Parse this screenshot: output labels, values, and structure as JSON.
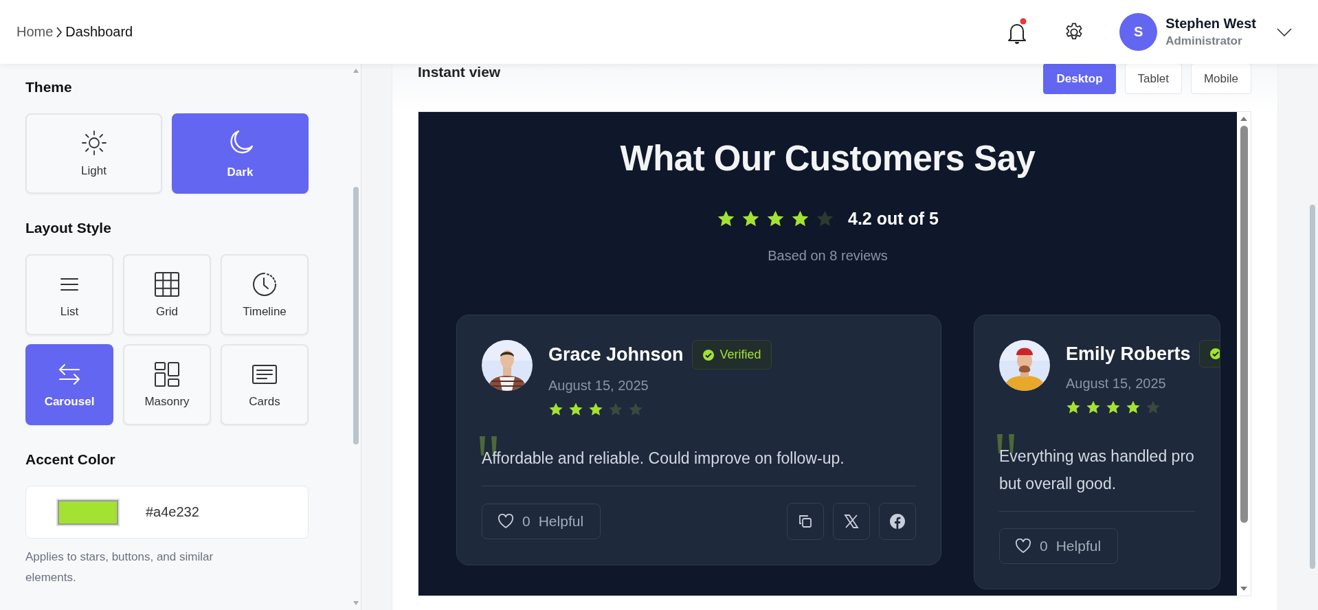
{
  "breadcrumb": [
    {
      "label": "Home"
    },
    {
      "label": "Dashboard"
    }
  ],
  "header": {
    "notifications": {
      "unread": true
    },
    "user": {
      "initial": "S",
      "name": "Stephen West",
      "role": "Administrator"
    }
  },
  "sidebar": {
    "theme": {
      "title": "Theme",
      "options": [
        {
          "label": "Light",
          "kind": "sun",
          "selected": false
        },
        {
          "label": "Dark",
          "kind": "moon",
          "selected": true
        }
      ]
    },
    "layout_style": {
      "title": "Layout Style",
      "options": [
        {
          "label": "List",
          "kind": "list",
          "selected": false
        },
        {
          "label": "Grid",
          "kind": "grid",
          "selected": false
        },
        {
          "label": "Timeline",
          "kind": "timeline",
          "selected": false
        },
        {
          "label": "Carousel",
          "kind": "carousel",
          "selected": true
        },
        {
          "label": "Masonry",
          "kind": "masonry",
          "selected": false
        },
        {
          "label": "Cards",
          "kind": "cards",
          "selected": false
        }
      ]
    },
    "accent_color": {
      "title": "Accent Color",
      "value": "#a4e232",
      "help": "Applies to stars, buttons, and similar elements."
    }
  },
  "preview": {
    "title": "Instant view",
    "devices": [
      {
        "label": "Desktop",
        "selected": true
      },
      {
        "label": "Tablet",
        "selected": false
      },
      {
        "label": "Mobile",
        "selected": false
      }
    ],
    "heading": "What Our Customers Say",
    "stars": 4,
    "rating": "4.2 out of 5",
    "summary": "Based on 8 reviews",
    "reviews": [
      {
        "name": "Grace Johnson",
        "verified": true,
        "badge": "Verified",
        "date": "August 15, 2025",
        "stars": 3,
        "quote_lines": [
          "Affordable and reliable. Could improve on follow-up."
        ],
        "helpful_count": "0",
        "helpful_label": "Helpful",
        "share": [
          {
            "kind": "copy"
          },
          {
            "kind": "x"
          },
          {
            "kind": "facebook"
          }
        ]
      },
      {
        "name": "Emily Roberts",
        "verified": true,
        "date": "August 15, 2025",
        "stars": 4,
        "quote_lines": [
          "Everything was handled pro",
          "but overall good."
        ],
        "helpful_count": "0",
        "helpful_label": "Helpful"
      }
    ]
  }
}
